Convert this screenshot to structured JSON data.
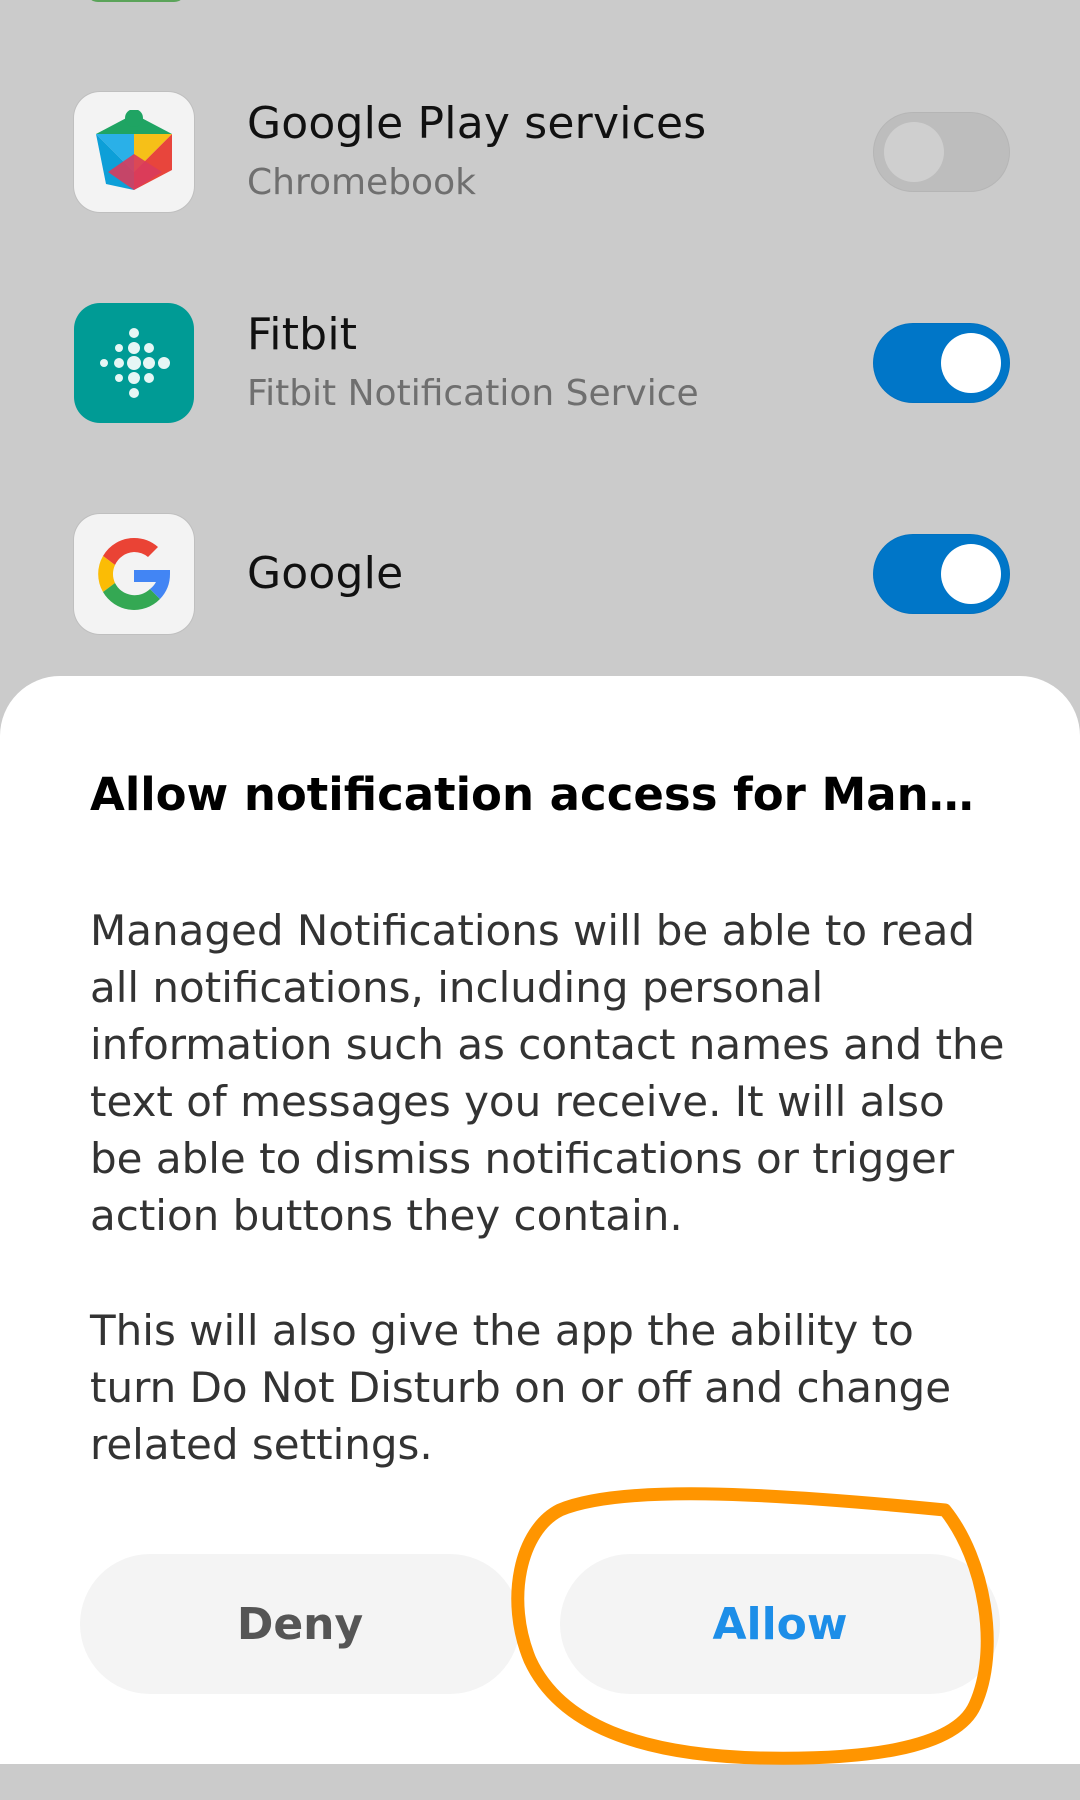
{
  "apps": [
    {
      "name": "Google Play services",
      "subtitle": "Chromebook",
      "icon": "google-play-services-icon",
      "enabled": false
    },
    {
      "name": "Fitbit",
      "subtitle": "Fitbit Notification Service",
      "icon": "fitbit-icon",
      "enabled": true
    },
    {
      "name": "Google",
      "subtitle": "",
      "icon": "google-g-icon",
      "enabled": true
    }
  ],
  "dialog": {
    "title": "Allow notification access for Manag…",
    "body_1": "Managed Notifications will be able to read all notifications, including personal information such as contact names and the text of messages you receive. It will also be able to dismiss notifications or trigger action buttons they contain.",
    "body_2": "This will also give the app the ability to turn Do Not Disturb on or off and change related settings.",
    "deny_label": "Deny",
    "allow_label": "Allow"
  },
  "colors": {
    "toggle_on": "#0076c8",
    "allow_text": "#1d8ee8",
    "highlight": "#ff9500",
    "scrim": "#cbcbcb"
  }
}
